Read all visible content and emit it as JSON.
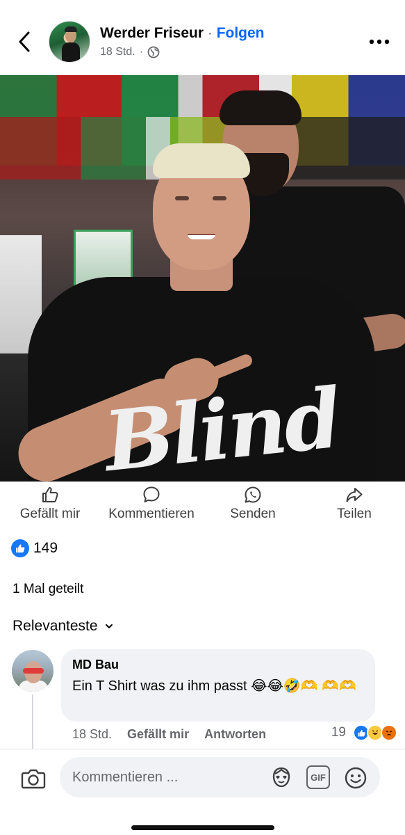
{
  "header": {
    "page_name": "Werder Friseur",
    "separator": "·",
    "follow_label": "Folgen",
    "post_time": "18 Std.",
    "meta_separator": "·"
  },
  "photo": {
    "shirt_text": "Blind"
  },
  "actions": {
    "like_label": "Gefällt mir",
    "comment_label": "Kommentieren",
    "send_label": "Senden",
    "share_label": "Teilen"
  },
  "reactions": {
    "count": "149"
  },
  "shares": {
    "text": "1 Mal geteilt"
  },
  "sort": {
    "label": "Relevanteste"
  },
  "comment": {
    "author": "MD Bau",
    "text": "Ein T Shirt was zu ihm passt 😂😂🤣🫶 🫶🫶",
    "time": "18 Std.",
    "like_label": "Gefällt mir",
    "reply_label": "Antworten",
    "reaction_count": "19"
  },
  "composer": {
    "placeholder": "Kommentieren ..."
  },
  "icons": {
    "back": "chevron-left-icon",
    "globe": "globe-icon",
    "more": "more-icon",
    "camera": "camera-icon",
    "avatar_sticker": "avatar-sticker-icon",
    "gif": "GIF",
    "emoji": "emoji-icon"
  },
  "colors": {
    "accent": "#0866ff",
    "like_blue": "#1877f2",
    "secondary_text": "#65676b",
    "bubble_bg": "#f0f2f5"
  }
}
